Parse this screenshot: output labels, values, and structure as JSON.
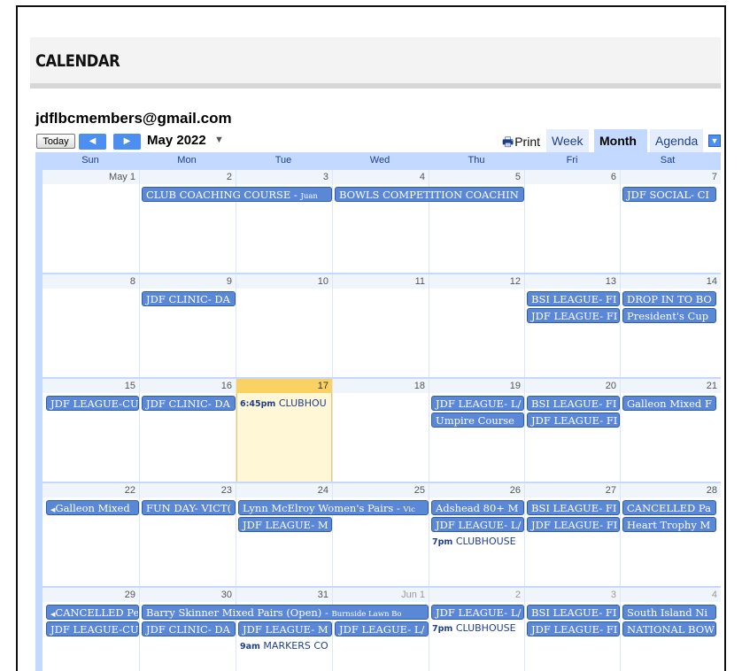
{
  "page": {
    "title": "CALENDAR"
  },
  "calendar": {
    "name": "jdflbcmembers@gmail.com",
    "today_label": "Today",
    "prev_icon": "chevron-left-icon",
    "next_icon": "chevron-right-icon",
    "month": "May 2022",
    "print_label": "Print",
    "views": [
      {
        "label": "Week",
        "active": false
      },
      {
        "label": "Month",
        "active": true
      },
      {
        "label": "Agenda",
        "active": false
      }
    ],
    "weekdays": [
      "Sun",
      "Mon",
      "Tue",
      "Wed",
      "Thu",
      "Fri",
      "Sat"
    ],
    "weeks": [
      {
        "days": [
          "May 1",
          "2",
          "3",
          "4",
          "5",
          "6",
          "7"
        ]
      },
      {
        "days": [
          "8",
          "9",
          "10",
          "11",
          "12",
          "13",
          "14"
        ]
      },
      {
        "days": [
          "15",
          "16",
          "17",
          "18",
          "19",
          "20",
          "21"
        ]
      },
      {
        "days": [
          "22",
          "23",
          "24",
          "25",
          "26",
          "27",
          "28"
        ]
      },
      {
        "days": [
          "29",
          "30",
          "31",
          "Jun 1",
          "2",
          "3",
          "4"
        ]
      }
    ],
    "events": {
      "w0": [
        "CLUB COACHING COURSE - ",
        "Juan",
        "BOWLS COMPETITION COACHIN",
        "JDF SOCIAL- CI"
      ],
      "w1": [
        "JDF CLINIC- DA",
        "BSI LEAGUE- FI",
        "DROP IN TO BO",
        "JDF LEAGUE- FI",
        "President's Cup"
      ],
      "w2": [
        "JDF LEAGUE-CU",
        "JDF CLINIC- DA",
        "6:45pm",
        "CLUBHOU",
        "JDF LEAGUE- L/",
        "BSI LEAGUE- FI",
        "Galleon Mixed F",
        "Umpire Course",
        "JDF LEAGUE- FI"
      ],
      "w3": [
        "Galleon Mixed",
        "FUN DAY- VICT(",
        "Lynn McElroy Women's Pairs - ",
        "Vic",
        "Adshead 80+ M",
        "BSI LEAGUE- FI",
        "CANCELLED Pa",
        "JDF LEAGUE- M",
        "JDF LEAGUE- L/",
        "JDF LEAGUE- FI",
        "Heart Trophy M",
        "7pm",
        "CLUBHOUSE"
      ],
      "w4": [
        "CANCELLED Pe",
        "Barry Skinner Mixed Pairs (Open) - ",
        "Burnside Lawn Bo",
        "JDF LEAGUE- L/",
        "BSI LEAGUE- FI",
        "South Island Ni",
        "JDF LEAGUE-CU",
        "JDF CLINIC- DA",
        "JDF LEAGUE- M",
        "JDF LEAGUE- L/",
        "7pm",
        "CLUBHOUSE",
        "JDF LEAGUE- FI",
        "NATIONAL BOW",
        "9am",
        "MARKERS CO"
      ]
    }
  }
}
